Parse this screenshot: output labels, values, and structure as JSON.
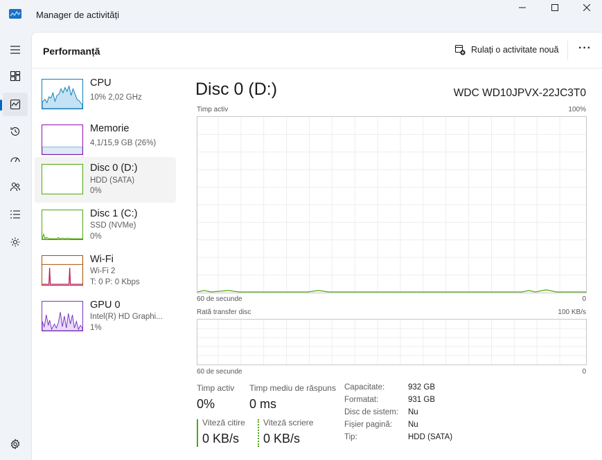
{
  "window": {
    "title": "Manager de activități",
    "controls": {
      "minimize": "—",
      "maximize": "☐",
      "close": "✕"
    }
  },
  "rail": {
    "items": [
      "menu-icon",
      "processes-icon",
      "performance-icon",
      "history-icon",
      "startup-icon",
      "users-icon",
      "details-icon",
      "services-icon",
      "settings-icon"
    ]
  },
  "header": {
    "title": "Performanță",
    "run_task_label": "Rulați o activitate nouă",
    "more_label": "···"
  },
  "resources": [
    {
      "name": "CPU",
      "sub1": "10% 2,02 GHz",
      "sub2": "",
      "color": "#117dbb",
      "fill": "#c4e2f3"
    },
    {
      "name": "Memorie",
      "sub1": "4,1/15,9 GB (26%)",
      "sub2": "",
      "color": "#8b12ae",
      "fill": "#dcebf7"
    },
    {
      "name": "Disc 0 (D:)",
      "sub1": "HDD (SATA)",
      "sub2": "0%",
      "color": "#4da60c",
      "fill": "#eaf5df"
    },
    {
      "name": "Disc 1 (C:)",
      "sub1": "SSD (NVMe)",
      "sub2": "0%",
      "color": "#4da60c",
      "fill": "#eaf5df"
    },
    {
      "name": "Wi-Fi",
      "sub1": "Wi-Fi 2",
      "sub2": "T: 0 P: 0 Kbps",
      "color": "#a74f01",
      "fill": "#ffffff"
    },
    {
      "name": "GPU 0",
      "sub1": "Intel(R) HD Graphi...",
      "sub2": "1%",
      "color": "#7a33c4",
      "fill": "#e9ddf6"
    }
  ],
  "detail": {
    "title": "Disc 0 (D:)",
    "model": "WDC WD10JPVX-22JC3T0",
    "graph1": {
      "label": "Timp activ",
      "max": "100%",
      "time": "60 de secunde",
      "min": "0"
    },
    "graph2": {
      "label": "Rată transfer disc",
      "max": "100 KB/s",
      "time": "60 de secunde",
      "min": "0"
    },
    "stats": {
      "active_time_label": "Timp activ",
      "active_time_value": "0%",
      "response_label": "Timp mediu de răspuns",
      "response_value": "0 ms",
      "read_label": "Viteză citire",
      "read_value": "0 KB/s",
      "write_label": "Viteză scriere",
      "write_value": "0 KB/s"
    },
    "properties": [
      {
        "key": "Capacitate:",
        "value": "932 GB"
      },
      {
        "key": "Formatat:",
        "value": "931 GB"
      },
      {
        "key": "Disc de sistem:",
        "value": "Nu"
      },
      {
        "key": "Fișier pagină:",
        "value": "Nu"
      },
      {
        "key": "Tip:",
        "value": "HDD (SATA)"
      }
    ],
    "accent": "#4da60c"
  }
}
